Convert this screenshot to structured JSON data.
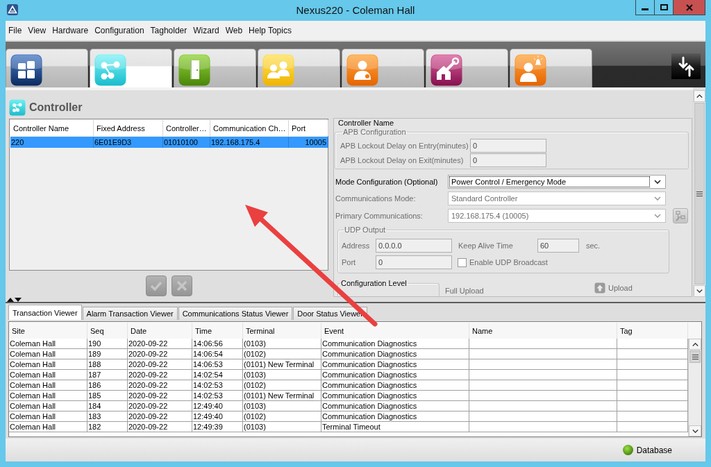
{
  "window": {
    "title": "Nexus220 - Coleman Hall"
  },
  "menu": [
    "File",
    "View",
    "Hardware",
    "Configuration",
    "Tagholder",
    "Wizard",
    "Web",
    "Help Topics"
  ],
  "module_tabs": [
    {
      "kind": "grid",
      "selected": false
    },
    {
      "kind": "network",
      "selected": true
    },
    {
      "kind": "door",
      "selected": false
    },
    {
      "kind": "people",
      "selected": false
    },
    {
      "kind": "person",
      "selected": false
    },
    {
      "kind": "house",
      "selected": false
    },
    {
      "kind": "alert",
      "selected": false
    }
  ],
  "controller": {
    "title": "Controller",
    "table": {
      "columns": [
        "Controller Name",
        "Fixed Address",
        "Controller…",
        "Communication Ch…",
        "Port"
      ],
      "rows": [
        {
          "cells": [
            "220",
            "6E01E9D3",
            "01010100",
            "192.168.175.4",
            "10005"
          ],
          "selected": true
        }
      ]
    },
    "buttons": [
      {
        "kind": "confirm",
        "disabled": true
      },
      {
        "kind": "cancel",
        "disabled": true
      }
    ]
  },
  "settings": {
    "section_label": "Controller Name",
    "apb": {
      "title": "APB Configuration",
      "disabled": true,
      "fields": [
        {
          "label": "APB Lockout Delay on Entry(minutes)",
          "value": "0"
        },
        {
          "label": "APB Lockout Delay on Exit(minutes)",
          "value": "0"
        }
      ]
    },
    "selects": [
      {
        "label": "Mode Configuration (Optional)",
        "value": "Power Control / Emergency Mode",
        "disabled": false,
        "focused": true
      },
      {
        "label": "Communications Mode:",
        "value": "Standard Controller",
        "disabled": true,
        "focused": false
      },
      {
        "label": "Primary Communications:",
        "value": "192.168.175.4 (10005)",
        "disabled": true,
        "focused": false,
        "side_button": {
          "disabled": true
        }
      }
    ],
    "udp": {
      "title": "UDP Output",
      "disabled": true,
      "address": {
        "label": "Address",
        "value": "0.0.0.0"
      },
      "port": {
        "label": "Port",
        "value": "0"
      },
      "keep_alive": {
        "label": "Keep Alive Time",
        "value": "60",
        "unit": "sec."
      },
      "broadcast": {
        "label": "Enable UDP Broadcast",
        "checked": false
      }
    },
    "configuration_level": {
      "title": "Configuration Level"
    },
    "full_upload": {
      "label": "Full Upload",
      "disabled": true
    },
    "upload_button": {
      "label": "Upload",
      "disabled": true
    }
  },
  "viewer": {
    "tabs": [
      {
        "label": "Transaction Viewer",
        "selected": true
      },
      {
        "label": "Alarm Transaction Viewer",
        "selected": false
      },
      {
        "label": "Communications Status Viewer",
        "selected": false
      },
      {
        "label": "Door Status Viewer",
        "selected": false
      }
    ],
    "table": {
      "columns": [
        "Site",
        "Seq",
        "Date",
        "Time",
        "Terminal",
        "Event",
        "Name",
        "Tag"
      ],
      "rows": [
        [
          "Coleman Hall",
          "190",
          "2020-09-22",
          "14:06:56",
          "(0103)",
          "Communication Diagnostics"
        ],
        [
          "Coleman Hall",
          "189",
          "2020-09-22",
          "14:06:54",
          "(0102)",
          "Communication Diagnostics"
        ],
        [
          "Coleman Hall",
          "188",
          "2020-09-22",
          "14:06:53",
          "(0101) New Terminal",
          "Communication Diagnostics"
        ],
        [
          "Coleman Hall",
          "187",
          "2020-09-22",
          "14:02:54",
          "(0103)",
          "Communication Diagnostics"
        ],
        [
          "Coleman Hall",
          "186",
          "2020-09-22",
          "14:02:53",
          "(0102)",
          "Communication Diagnostics"
        ],
        [
          "Coleman Hall",
          "185",
          "2020-09-22",
          "14:02:53",
          "(0101) New Terminal",
          "Communication Diagnostics"
        ],
        [
          "Coleman Hall",
          "184",
          "2020-09-22",
          "12:49:40",
          "(0103)",
          "Communication Diagnostics"
        ],
        [
          "Coleman Hall",
          "183",
          "2020-09-22",
          "12:49:40",
          "(0102)",
          "Communication Diagnostics"
        ],
        [
          "Coleman Hall",
          "182",
          "2020-09-22",
          "12:49:39",
          "(0103)",
          "Terminal Timeout"
        ]
      ]
    }
  },
  "status_bar": {
    "database": {
      "label": "Database",
      "online": true
    }
  },
  "annotations": [
    {
      "kind": "arrow"
    }
  ]
}
